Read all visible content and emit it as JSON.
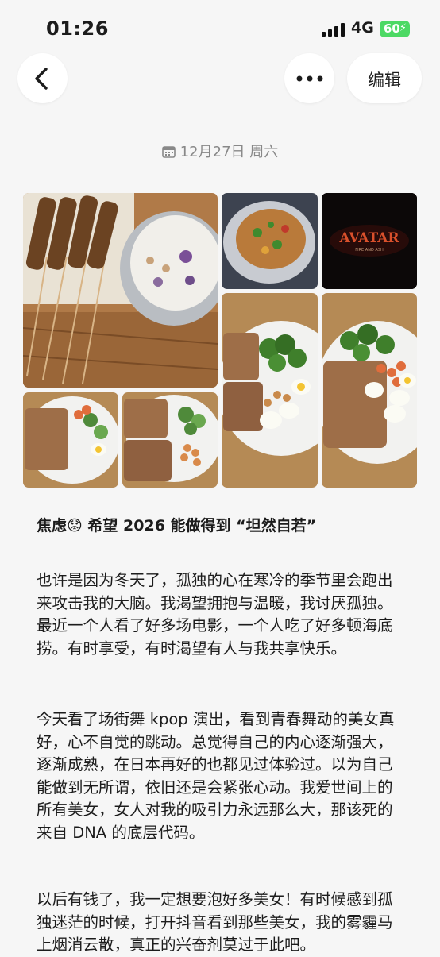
{
  "status_bar": {
    "time": "01:26",
    "network": "4G",
    "battery": "60"
  },
  "nav": {
    "edit_label": "编辑"
  },
  "entry": {
    "date": "12月27日 周六",
    "photos": [
      {
        "icon": "food-photo-skewers-and-dessert"
      },
      {
        "icon": "food-photo-stir-fry"
      },
      {
        "icon": "avatar-poster-photo",
        "poster_title": "AVATAR",
        "poster_subtitle": "FIRE AND ASH"
      },
      {
        "icon": "food-photo-toast-broccoli-egg"
      },
      {
        "icon": "food-photo-toast-broccoli-shrimp-egg"
      },
      {
        "icon": "food-photo-toast-cucumber-egg"
      },
      {
        "icon": "food-photo-toast-cucumber-shrimp"
      }
    ],
    "title": "焦虑😟 希望 2026 能做得到 “坦然自若”",
    "paragraphs": [
      "也许是因为冬天了，孤独的心在寒冷的季节里会跑出来攻击我的大脑。我渴望拥抱与温暖，我讨厌孤独。最近一个人看了好多场电影，一个人吃了好多顿海底捞。有时享受，有时渴望有人与我共享快乐。",
      "今天看了场街舞 kpop 演出，看到青春舞动的美女真好，心不自觉的跳动。总觉得自己的内心逐渐强大，逐渐成熟，在日本再好的也都见过体验过。以为自己能做到无所谓，依旧还是会紧张心动。我爱世间上的所有美女，女人对我的吸引力永远那么大，那该死的来自 DNA 的底层代码。",
      "以后有钱了，我一定想要泡好多美女！有时候感到孤独迷茫的时候，打开抖音看到那些美女，我的雾霾马上烟消云散，真正的兴奋剂莫过于此吧。"
    ]
  }
}
